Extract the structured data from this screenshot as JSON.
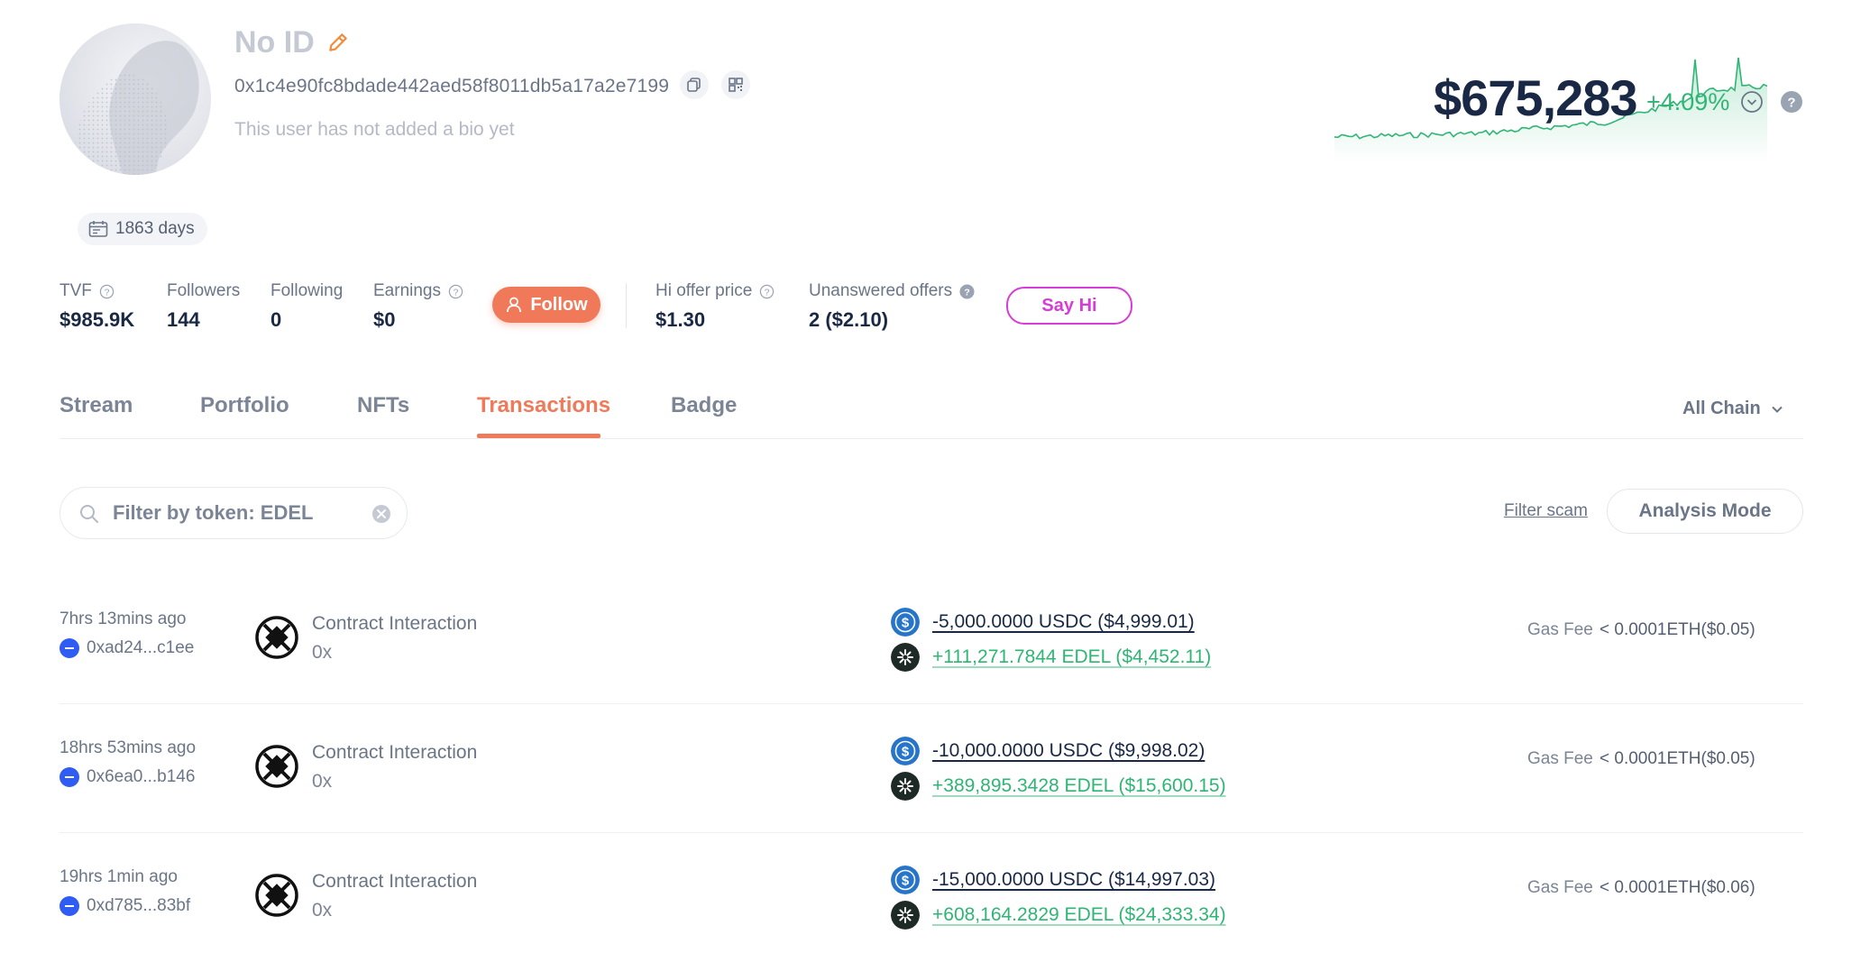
{
  "profile": {
    "name": "No ID",
    "address": "0x1c4e90fc8bdade442aed58f8011db5a17a2e7199",
    "bio": "This user has not added a bio yet",
    "days": "1863 days"
  },
  "networth": {
    "value": "$675,283",
    "change": "+4.09%",
    "change_color": "#2fb574"
  },
  "stats": {
    "tvf": {
      "label": "TVF",
      "value": "$985.9K"
    },
    "followers": {
      "label": "Followers",
      "value": "144"
    },
    "following": {
      "label": "Following",
      "value": "0"
    },
    "earnings": {
      "label": "Earnings",
      "value": "$0"
    },
    "follow_label": "Follow",
    "hi_offer": {
      "label": "Hi offer price",
      "value": "$1.30"
    },
    "unanswered": {
      "label": "Unanswered offers",
      "value": "2 ($2.10)"
    },
    "sayhi_label": "Say Hi"
  },
  "tabs": [
    {
      "label": "Stream"
    },
    {
      "label": "Portfolio"
    },
    {
      "label": "NFTs"
    },
    {
      "label": "Transactions",
      "active": true
    },
    {
      "label": "Badge"
    }
  ],
  "chain_filter": "All Chain",
  "filter": {
    "placeholder": "Filter by token: EDEL",
    "filter_scam": "Filter scam",
    "analysis_mode": "Analysis Mode"
  },
  "colors": {
    "accent": "#f0795a",
    "sayhi": "#d63cd6",
    "positive": "#2fb574",
    "usdc": "#2775ca",
    "edel": "#1e2a26",
    "chain": "#2f5cf2"
  },
  "transactions": [
    {
      "time": "7hrs 13mins ago",
      "hash": "0xad24...c1ee",
      "type": "Contract Interaction",
      "address": "0x",
      "out": "-5,000.0000 USDC ($4,999.01)",
      "in": "+111,271.7844 EDEL ($4,452.11)",
      "gas_label": "Gas Fee",
      "gas": "< 0.0001ETH($0.05)"
    },
    {
      "time": "18hrs 53mins ago",
      "hash": "0x6ea0...b146",
      "type": "Contract Interaction",
      "address": "0x",
      "out": "-10,000.0000 USDC ($9,998.02)",
      "in": "+389,895.3428 EDEL ($15,600.15)",
      "gas_label": "Gas Fee",
      "gas": "< 0.0001ETH($0.05)"
    },
    {
      "time": "19hrs 1min ago",
      "hash": "0xd785...83bf",
      "type": "Contract Interaction",
      "address": "0x",
      "out": "-15,000.0000 USDC ($14,997.03)",
      "in": "+608,164.2829 EDEL ($24,333.34)",
      "gas_label": "Gas Fee",
      "gas": "< 0.0001ETH($0.06)"
    }
  ]
}
